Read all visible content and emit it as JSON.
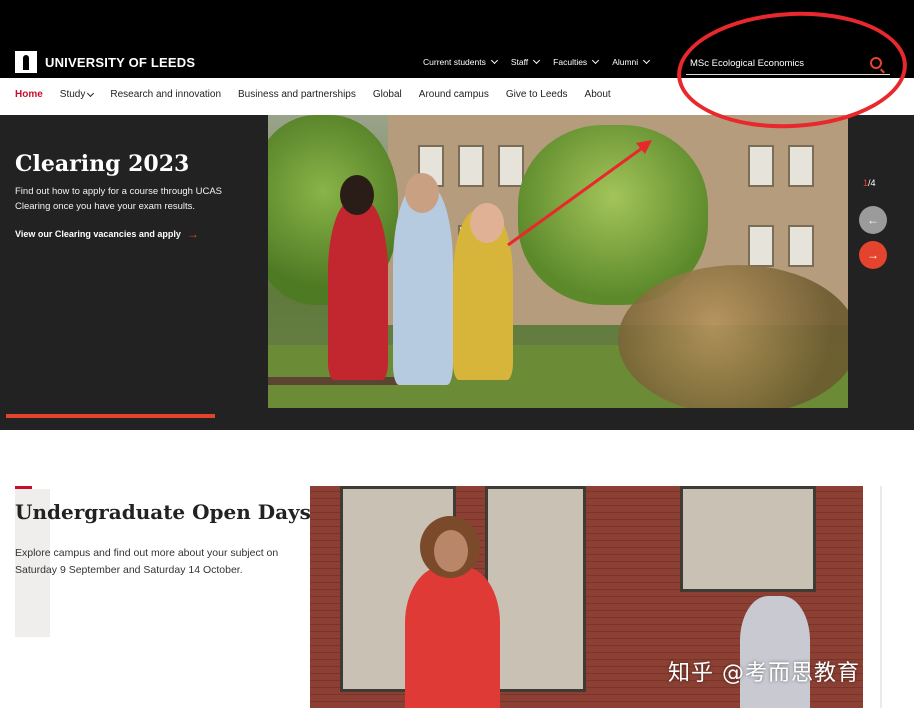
{
  "header": {
    "logo_text": "UNIVERSITY OF LEEDS",
    "top_nav": [
      {
        "label": "Current students"
      },
      {
        "label": "Staff"
      },
      {
        "label": "Faculties"
      },
      {
        "label": "Alumni"
      }
    ],
    "search": {
      "value": "MSc Ecological Economics"
    }
  },
  "main_nav": {
    "items": [
      {
        "label": "Home",
        "active": true
      },
      {
        "label": "Study",
        "has_dropdown": true
      },
      {
        "label": "Research and innovation"
      },
      {
        "label": "Business and partnerships"
      },
      {
        "label": "Global"
      },
      {
        "label": "Around campus"
      },
      {
        "label": "Give to Leeds"
      },
      {
        "label": "About"
      }
    ]
  },
  "hero": {
    "title": "Clearing 2023",
    "description": "Find out how to apply for a course through UCAS Clearing once you have your exam results.",
    "link_label": "View our Clearing vacancies and apply",
    "slide_current": "1",
    "slide_sep": "/",
    "slide_total": "4",
    "prev_icon": "←",
    "next_icon": "→"
  },
  "open_days": {
    "title": "Undergraduate Open Days",
    "description": "Explore campus and find out more about your subject on Saturday 9 September and Saturday 14 October."
  },
  "watermark": "知乎 @考而思教育",
  "colors": {
    "accent": "#e4442d",
    "brand_red": "#c8102e",
    "annotation": "#e8282d",
    "hero_bg": "#222222"
  }
}
